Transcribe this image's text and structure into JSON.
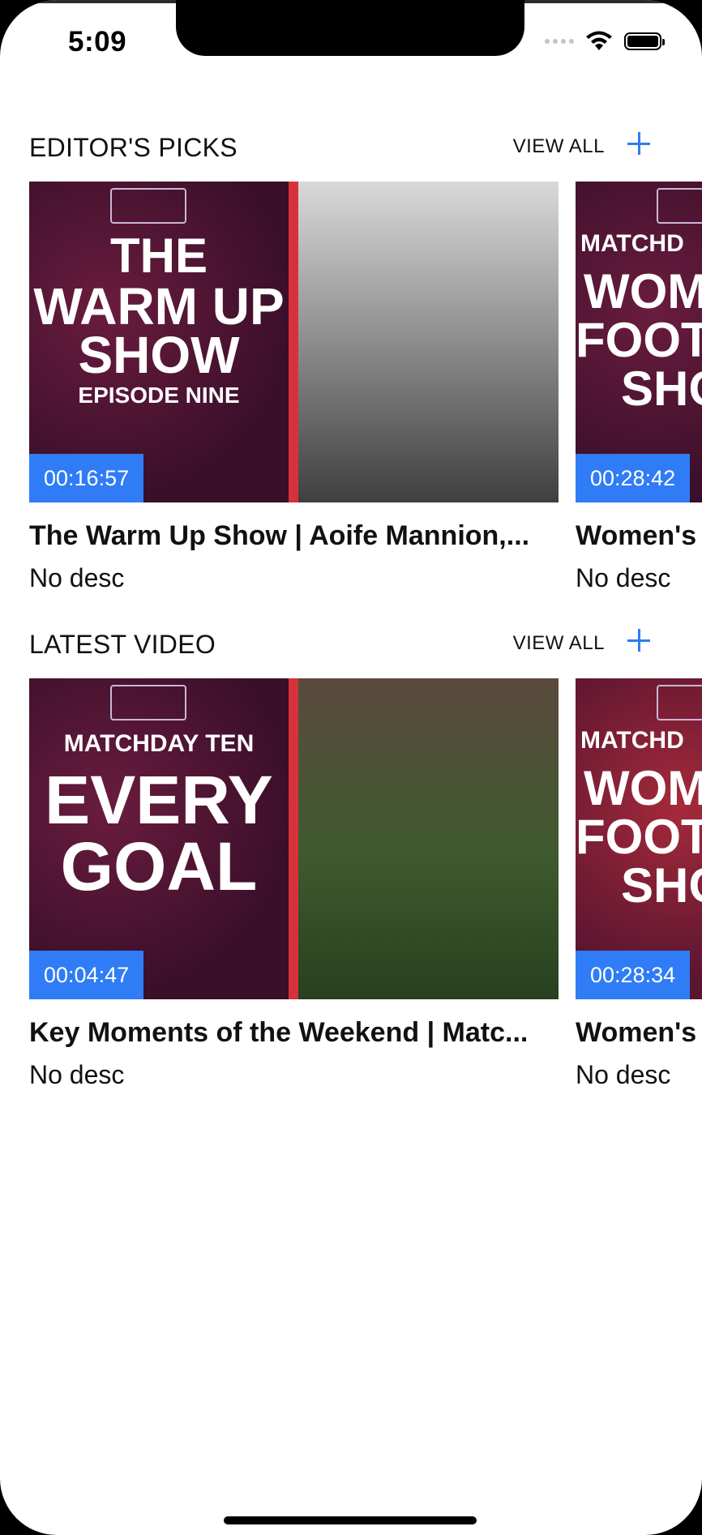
{
  "status_bar": {
    "time": "5:09"
  },
  "sections": [
    {
      "title": "EDITOR'S PICKS",
      "view_all": "VIEW ALL",
      "cards": [
        {
          "title": "The Warm Up Show | Aoife Mannion,...",
          "desc": "No desc",
          "duration": "00:16:57",
          "thumb_lines": [
            "THE",
            "WARM UP",
            "SHOW",
            "EPISODE NINE"
          ]
        },
        {
          "title": "Women's",
          "desc": "No desc",
          "duration": "00:28:42",
          "thumb_lines": [
            "MATCHD",
            "WOM",
            "FOOT",
            "SHO"
          ]
        }
      ]
    },
    {
      "title": "LATEST VIDEO",
      "view_all": "VIEW ALL",
      "cards": [
        {
          "title": "Key Moments of the Weekend | Matc...",
          "desc": "No desc",
          "duration": "00:04:47",
          "thumb_lines": [
            "MATCHDAY TEN",
            "EVERY",
            "GOAL"
          ]
        },
        {
          "title": "Women's",
          "desc": "No desc",
          "duration": "00:28:34",
          "thumb_lines": [
            "MATCHD",
            "WOM",
            "FOOT",
            "SHO"
          ]
        }
      ]
    }
  ],
  "colors": {
    "accent": "#2f7cf6",
    "thumb_dark": "#3a0f2a",
    "stripe": "#d7323c"
  }
}
